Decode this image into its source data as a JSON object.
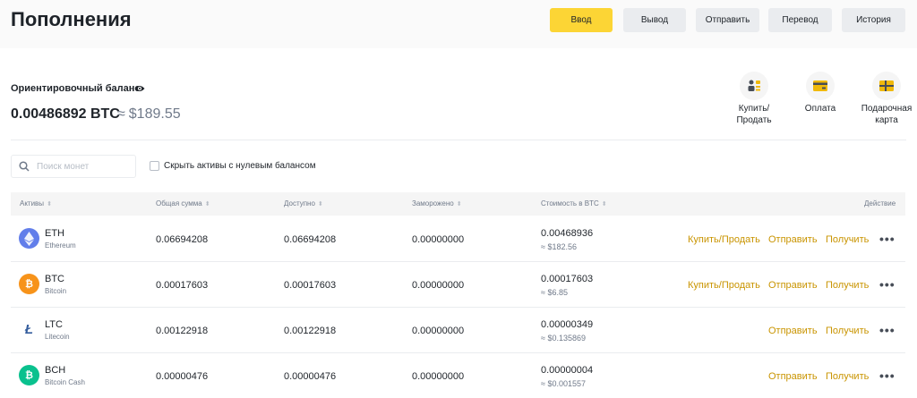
{
  "header": {
    "title": "Пополнения",
    "buttons": {
      "deposit": "Ввод",
      "withdraw": "Вывод",
      "send": "Отправить",
      "transfer": "Перевод",
      "history": "История"
    }
  },
  "balance": {
    "label": "Ориентировочный баланс",
    "btc": "0.00486892 BTC",
    "approx": "≈",
    "usd": "$189.55"
  },
  "quick_actions": {
    "buy_sell_line1": "Купить/",
    "buy_sell_line2": "Продать",
    "payment": "Оплата",
    "gift_line1": "Подарочная",
    "gift_line2": "карта"
  },
  "search": {
    "placeholder": "Поиск монет",
    "hide_zero_label": "Скрыть активы с нулевым балансом"
  },
  "table": {
    "columns": {
      "assets": "Активы",
      "total": "Общая сумма",
      "available": "Доступно",
      "frozen": "Заморожено",
      "btc_value": "Стоимость в BTC",
      "action": "Действие"
    },
    "action_labels": {
      "buy_sell": "Купить/Продать",
      "send": "Отправить",
      "receive": "Получить",
      "more": "•••"
    },
    "rows": [
      {
        "symbol": "ETH",
        "name": "Ethereum",
        "total": "0.06694208",
        "available": "0.06694208",
        "frozen": "0.00000000",
        "btc_value": "0.00468936",
        "usd_value": "≈ $182.56",
        "color": "#627eea"
      },
      {
        "symbol": "BTC",
        "name": "Bitcoin",
        "total": "0.00017603",
        "available": "0.00017603",
        "frozen": "0.00000000",
        "btc_value": "0.00017603",
        "usd_value": "≈ $6.85",
        "color": "#f7931a"
      },
      {
        "symbol": "LTC",
        "name": "Litecoin",
        "total": "0.00122918",
        "available": "0.00122918",
        "frozen": "0.00000000",
        "btc_value": "0.00000349",
        "usd_value": "≈ $0.135869",
        "color": "#345d9d"
      },
      {
        "symbol": "BCH",
        "name": "Bitcoin Cash",
        "total": "0.00000476",
        "available": "0.00000476",
        "frozen": "0.00000000",
        "btc_value": "0.00000004",
        "usd_value": "≈ $0.001557",
        "color": "#0ac18e"
      }
    ]
  },
  "colors": {
    "accent": "#fcd535",
    "link": "#c99400"
  }
}
